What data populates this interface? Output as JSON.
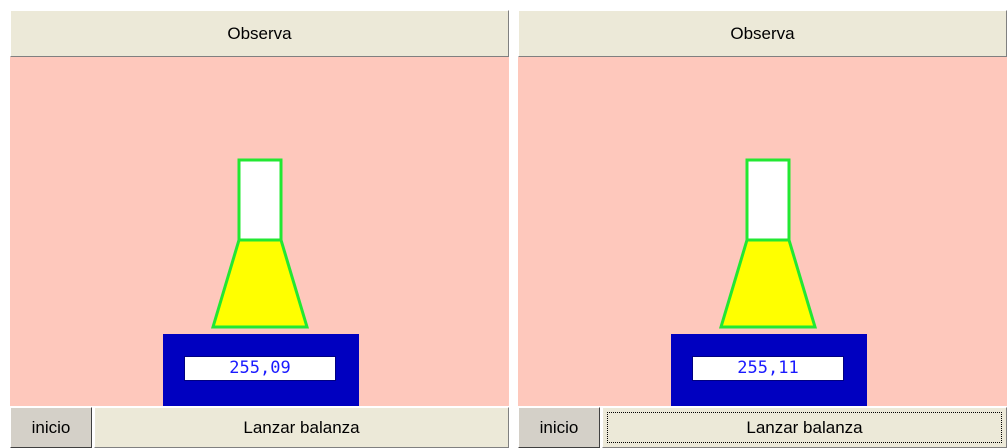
{
  "panels": [
    {
      "header_label": "Observa",
      "display_value": "255,09",
      "inicio_label": "inicio",
      "lanzar_label": "Lanzar balanza",
      "lanzar_focused": false
    },
    {
      "header_label": "Observa",
      "display_value": "255,11",
      "inicio_label": "inicio",
      "lanzar_label": "Lanzar balanza",
      "lanzar_focused": true
    }
  ],
  "colors": {
    "scene_background": "#fec8bc",
    "flask_outline": "#22e832",
    "flask_liquid": "#ffff00",
    "flask_neck": "#ffffff",
    "balance_body": "#0000c0",
    "display_text": "#1a1aff",
    "button_face": "#ece9d8"
  },
  "icons": {
    "flask": "erlenmeyer-flask-icon",
    "balance": "digital-balance-icon"
  }
}
